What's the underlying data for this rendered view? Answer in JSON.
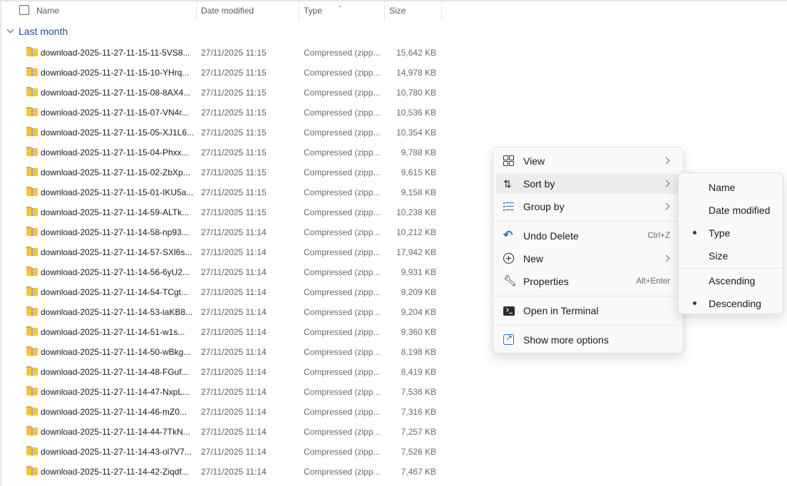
{
  "header": {
    "name": "Name",
    "date_modified": "Date modified",
    "type": "Type",
    "size": "Size"
  },
  "group": {
    "title": "Last month"
  },
  "files": [
    {
      "name": "download-2025-11-27-11-15-11-5VS8...",
      "date": "27/11/2025 11:15",
      "type": "Compressed (zipp...",
      "size": "15,642 KB"
    },
    {
      "name": "download-2025-11-27-11-15-10-YHrq...",
      "date": "27/11/2025 11:15",
      "type": "Compressed (zipp...",
      "size": "14,978 KB"
    },
    {
      "name": "download-2025-11-27-11-15-08-8AX4...",
      "date": "27/11/2025 11:15",
      "type": "Compressed (zipp...",
      "size": "10,780 KB"
    },
    {
      "name": "download-2025-11-27-11-15-07-VN4r...",
      "date": "27/11/2025 11:15",
      "type": "Compressed (zipp...",
      "size": "10,536 KB"
    },
    {
      "name": "download-2025-11-27-11-15-05-XJ1L6...",
      "date": "27/11/2025 11:15",
      "type": "Compressed (zipp...",
      "size": "10,354 KB"
    },
    {
      "name": "download-2025-11-27-11-15-04-Phxx...",
      "date": "27/11/2025 11:15",
      "type": "Compressed (zipp...",
      "size": "9,788 KB"
    },
    {
      "name": "download-2025-11-27-11-15-02-ZbXp...",
      "date": "27/11/2025 11:15",
      "type": "Compressed (zipp...",
      "size": "9,615 KB"
    },
    {
      "name": "download-2025-11-27-11-15-01-IKU5a...",
      "date": "27/11/2025 11:15",
      "type": "Compressed (zipp...",
      "size": "9,158 KB"
    },
    {
      "name": "download-2025-11-27-11-14-59-ALTk...",
      "date": "27/11/2025 11:15",
      "type": "Compressed (zipp...",
      "size": "10,238 KB"
    },
    {
      "name": "download-2025-11-27-11-14-58-np93...",
      "date": "27/11/2025 11:14",
      "type": "Compressed (zipp...",
      "size": "10,212 KB"
    },
    {
      "name": "download-2025-11-27-11-14-57-SXl6s...",
      "date": "27/11/2025 11:14",
      "type": "Compressed (zipp...",
      "size": "17,942 KB"
    },
    {
      "name": "download-2025-11-27-11-14-56-6yU2...",
      "date": "27/11/2025 11:14",
      "type": "Compressed (zipp...",
      "size": "9,931 KB"
    },
    {
      "name": "download-2025-11-27-11-14-54-TCgt...",
      "date": "27/11/2025 11:14",
      "type": "Compressed (zipp...",
      "size": "9,209 KB"
    },
    {
      "name": "download-2025-11-27-11-14-53-iaKB8...",
      "date": "27/11/2025 11:14",
      "type": "Compressed (zipp...",
      "size": "9,204 KB"
    },
    {
      "name": "download-2025-11-27-11-14-51-w1s...",
      "date": "27/11/2025 11:14",
      "type": "Compressed (zipp...",
      "size": "9,360 KB"
    },
    {
      "name": "download-2025-11-27-11-14-50-wBkg...",
      "date": "27/11/2025 11:14",
      "type": "Compressed (zipp...",
      "size": "8,198 KB"
    },
    {
      "name": "download-2025-11-27-11-14-48-FGuf...",
      "date": "27/11/2025 11:14",
      "type": "Compressed (zipp...",
      "size": "8,419 KB"
    },
    {
      "name": "download-2025-11-27-11-14-47-NxpL...",
      "date": "27/11/2025 11:14",
      "type": "Compressed (zipp...",
      "size": "7,536 KB"
    },
    {
      "name": "download-2025-11-27-11-14-46-mZ0...",
      "date": "27/11/2025 11:14",
      "type": "Compressed (zipp...",
      "size": "7,316 KB"
    },
    {
      "name": "download-2025-11-27-11-14-44-7TkN...",
      "date": "27/11/2025 11:14",
      "type": "Compressed (zipp...",
      "size": "7,257 KB"
    },
    {
      "name": "download-2025-11-27-11-14-43-ol7V7...",
      "date": "27/11/2025 11:14",
      "type": "Compressed (zipp...",
      "size": "7,526 KB"
    },
    {
      "name": "download-2025-11-27-11-14-42-Ziqdf...",
      "date": "27/11/2025 11:14",
      "type": "Compressed (zipp...",
      "size": "7,467 KB"
    }
  ],
  "context_menu": {
    "view": "View",
    "sort_by": "Sort by",
    "group_by": "Group by",
    "undo_delete": "Undo Delete",
    "undo_shortcut": "Ctrl+Z",
    "new": "New",
    "properties": "Properties",
    "properties_shortcut": "Alt+Enter",
    "open_terminal": "Open in Terminal",
    "show_more": "Show more options"
  },
  "sort_submenu": {
    "name": "Name",
    "date_modified": "Date modified",
    "type": "Type",
    "size": "Size",
    "ascending": "Ascending",
    "descending": "Descending",
    "selected_field": "Type",
    "selected_order": "Descending"
  },
  "colors": {
    "group_title": "#1e4f8c",
    "folder_zip": "#f5c244",
    "accent_icon": "#2f6fba"
  }
}
